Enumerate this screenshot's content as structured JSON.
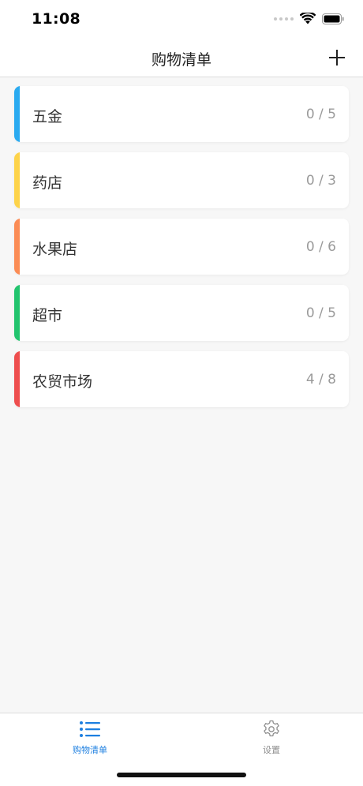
{
  "status_bar": {
    "time": "11:08"
  },
  "nav": {
    "title": "购物清单",
    "add_icon": "plus-icon"
  },
  "lists": [
    {
      "name": "五金",
      "count": "0 / 5",
      "color": "#2aaaf0"
    },
    {
      "name": "药店",
      "count": "0 / 3",
      "color": "#fdd34a"
    },
    {
      "name": "水果店",
      "count": "0 / 6",
      "color": "#fb8c55"
    },
    {
      "name": "超市",
      "count": "0 / 5",
      "color": "#22c46e"
    },
    {
      "name": "农贸市场",
      "count": "4 / 8",
      "color": "#ee4e4e"
    }
  ],
  "tabs": [
    {
      "label": "购物清单",
      "icon": "list-icon",
      "active": true
    },
    {
      "label": "设置",
      "icon": "gear-icon",
      "active": false
    }
  ],
  "colors": {
    "accent": "#1d7fe0",
    "inactive": "#8e8e8e"
  }
}
